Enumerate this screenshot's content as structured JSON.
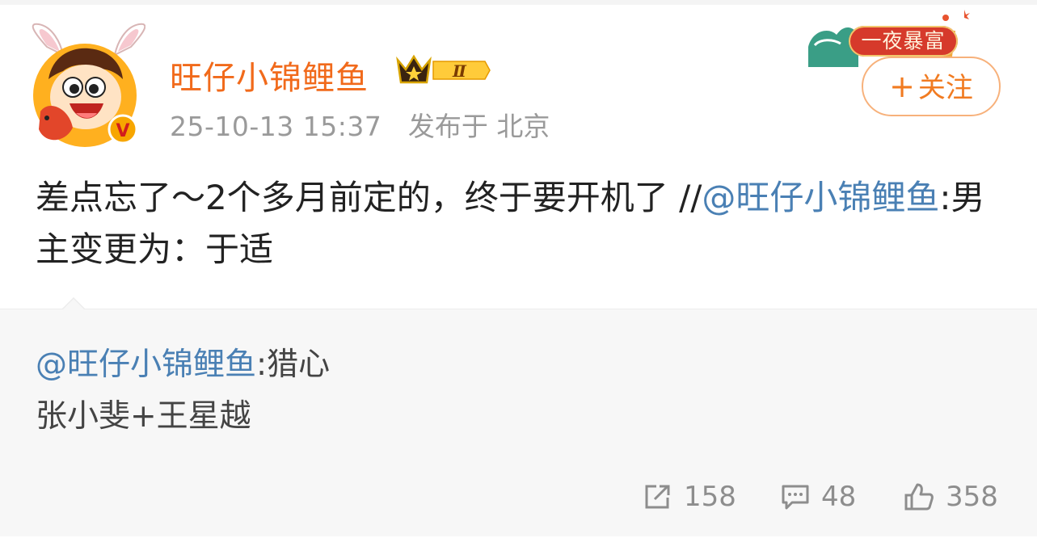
{
  "post": {
    "author": {
      "nickname": "旺仔小锦鲤鱼",
      "vip_level": "Ⅱ",
      "verified_mark": "V"
    },
    "timestamp": "25-10-13 15:37",
    "location": "发布于 北京",
    "follow_button": {
      "plus": "+",
      "label": "关注"
    },
    "promo_badge": "一夜暴富",
    "text": {
      "part1": "差点忘了～2个多月前定的，终于要开机了 //",
      "mention": "@旺仔小锦鲤鱼",
      "part2": ":男主变更为：于适"
    }
  },
  "repost": {
    "mention": "@旺仔小锦鲤鱼",
    "line1_rest": ":猎心",
    "line2": "张小斐+王星越"
  },
  "actions": {
    "share": {
      "icon": "share-icon",
      "count": "158"
    },
    "comment": {
      "icon": "comment-icon",
      "count": "48"
    },
    "like": {
      "icon": "thumbs-up-icon",
      "count": "358"
    }
  },
  "colors": {
    "nickname": "#f16a1b",
    "mention": "#4a80b4",
    "follow": "#f17b21",
    "meta": "#9a9a9a",
    "repost_bg": "#f7f7f7"
  }
}
